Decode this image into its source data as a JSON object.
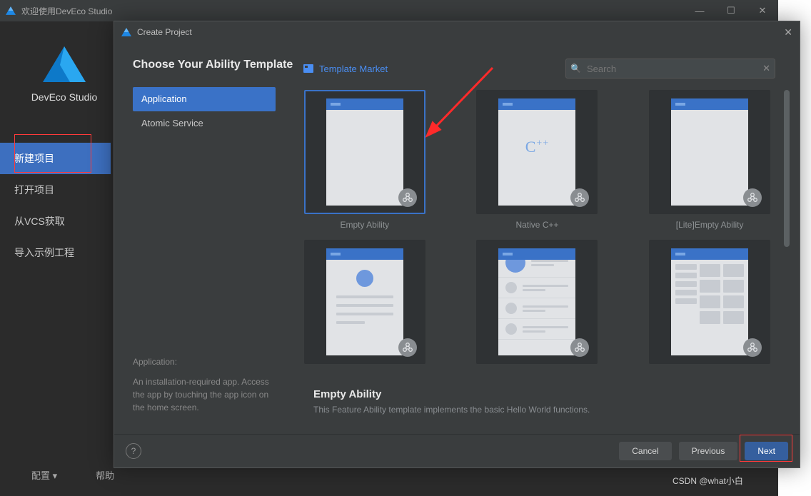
{
  "outer": {
    "title": "欢迎使用DevEco Studio",
    "app_name": "DevEco Studio",
    "menu": [
      "新建项目",
      "打开项目",
      "从VCS获取",
      "导入示例工程"
    ],
    "menu_selected": 0,
    "footer_config": "配置",
    "footer_help": "帮助"
  },
  "dialog": {
    "title": "Create Project",
    "heading": "Choose Your Ability Template",
    "categories": [
      "Application",
      "Atomic Service"
    ],
    "category_selected": 0,
    "category_desc_title": "Application:",
    "category_desc_body": "An installation-required app. Access the app by touching the app icon on the home screen.",
    "market_label": "Template Market",
    "search": {
      "placeholder": "Search",
      "value": ""
    },
    "templates": [
      {
        "name": "Empty Ability",
        "variant": "empty",
        "selected": true
      },
      {
        "name": "Native C++",
        "variant": "cpp",
        "selected": false
      },
      {
        "name": "[Lite]Empty Ability",
        "variant": "empty",
        "selected": false
      },
      {
        "name": "",
        "variant": "about",
        "selected": false
      },
      {
        "name": "",
        "variant": "list",
        "selected": false
      },
      {
        "name": "",
        "variant": "grid",
        "selected": false
      }
    ],
    "selected_template_title": "Empty Ability",
    "selected_template_desc": "This Feature Ability template implements the basic Hello World functions.",
    "buttons": {
      "cancel": "Cancel",
      "previous": "Previous",
      "next": "Next"
    }
  },
  "watermark": "CSDN @what小白",
  "colors": {
    "accent": "#3a72c7",
    "link": "#4a8ef3",
    "annot": "#ff3a3a"
  }
}
